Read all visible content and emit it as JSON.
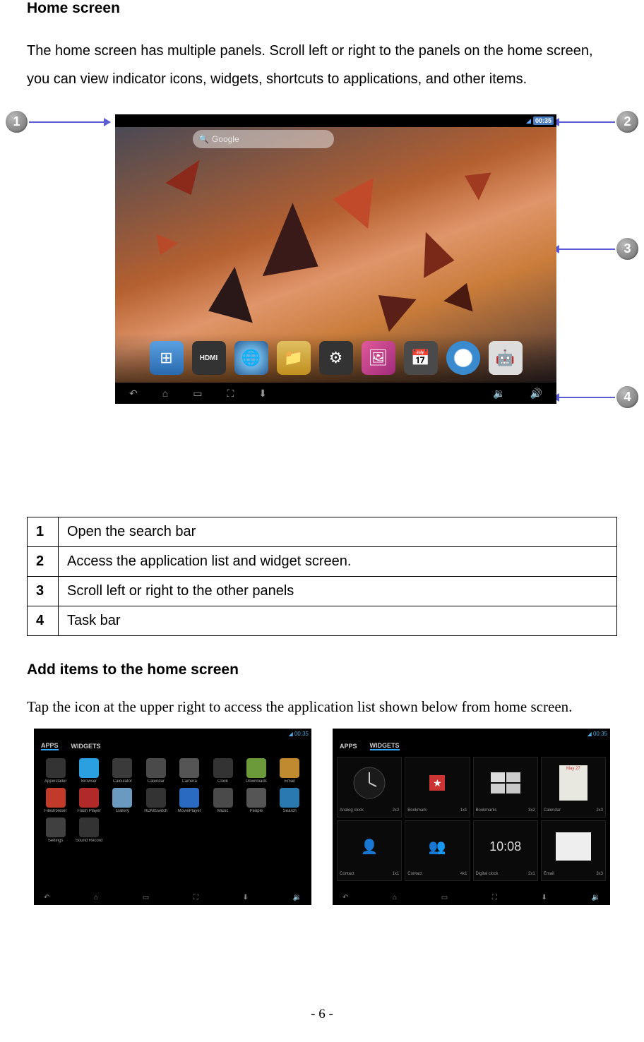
{
  "headings": {
    "home": "Home screen",
    "add_items": "Add items to the home screen"
  },
  "paragraphs": {
    "intro": "The home screen has multiple panels. Scroll left or right to the panels on the home screen, you can view indicator icons, widgets, shortcuts to applications, and other items.",
    "add_items_text": "Tap the icon at the upper right to access the application list shown below from home screen."
  },
  "device": {
    "status_time": "00:35",
    "search_label": "Google"
  },
  "callouts": {
    "n1": "1",
    "n2": "2",
    "n3": "3",
    "n4": "4"
  },
  "legend": [
    {
      "num": "1",
      "text": "Open the search bar"
    },
    {
      "num": "2",
      "text": "Access the application list and widget screen."
    },
    {
      "num": "3",
      "text": "Scroll left or right to the other panels"
    },
    {
      "num": "4",
      "text": "Task bar"
    }
  ],
  "thumbs": {
    "tabs_apps": "APPS",
    "tabs_widgets": "WIDGETS",
    "apps": [
      {
        "label": "Appinstaller",
        "color": "#333"
      },
      {
        "label": "Browser",
        "color": "#2aa0e0"
      },
      {
        "label": "Calculator",
        "color": "#3a3a3a"
      },
      {
        "label": "Calendar",
        "color": "#4a4a4a"
      },
      {
        "label": "Camera",
        "color": "#555"
      },
      {
        "label": "Clock",
        "color": "#333"
      },
      {
        "label": "Downloads",
        "color": "#6a9a3a"
      },
      {
        "label": "Email",
        "color": "#c08a30"
      },
      {
        "label": "FileBrowser",
        "color": "#c23a2a"
      },
      {
        "label": "Flash Player",
        "color": "#b02a2a"
      },
      {
        "label": "Gallery",
        "color": "#6a9ac0"
      },
      {
        "label": "HDMISwitch",
        "color": "#333"
      },
      {
        "label": "MoviePlayer",
        "color": "#2a6ac0"
      },
      {
        "label": "Music",
        "color": "#4a4a4a"
      },
      {
        "label": "People",
        "color": "#555"
      },
      {
        "label": "Search",
        "color": "#2a7ab0"
      },
      {
        "label": "Settings",
        "color": "#404040"
      },
      {
        "label": "Sound Record",
        "color": "#333"
      }
    ],
    "widgets": [
      {
        "label": "Analog clock",
        "size": "2x2"
      },
      {
        "label": "Bookmark",
        "size": "1x1"
      },
      {
        "label": "Bookmarks",
        "size": "3x2"
      },
      {
        "label": "Calendar",
        "size": "2x3"
      },
      {
        "label": "Contact",
        "size": "1x1"
      },
      {
        "label": "Contact",
        "size": "4x1"
      },
      {
        "label": "Digital clock",
        "size": "2x1"
      },
      {
        "label": "Email",
        "size": "3x3"
      }
    ],
    "digital_clock": "10:08"
  },
  "footer": "- 6 -"
}
